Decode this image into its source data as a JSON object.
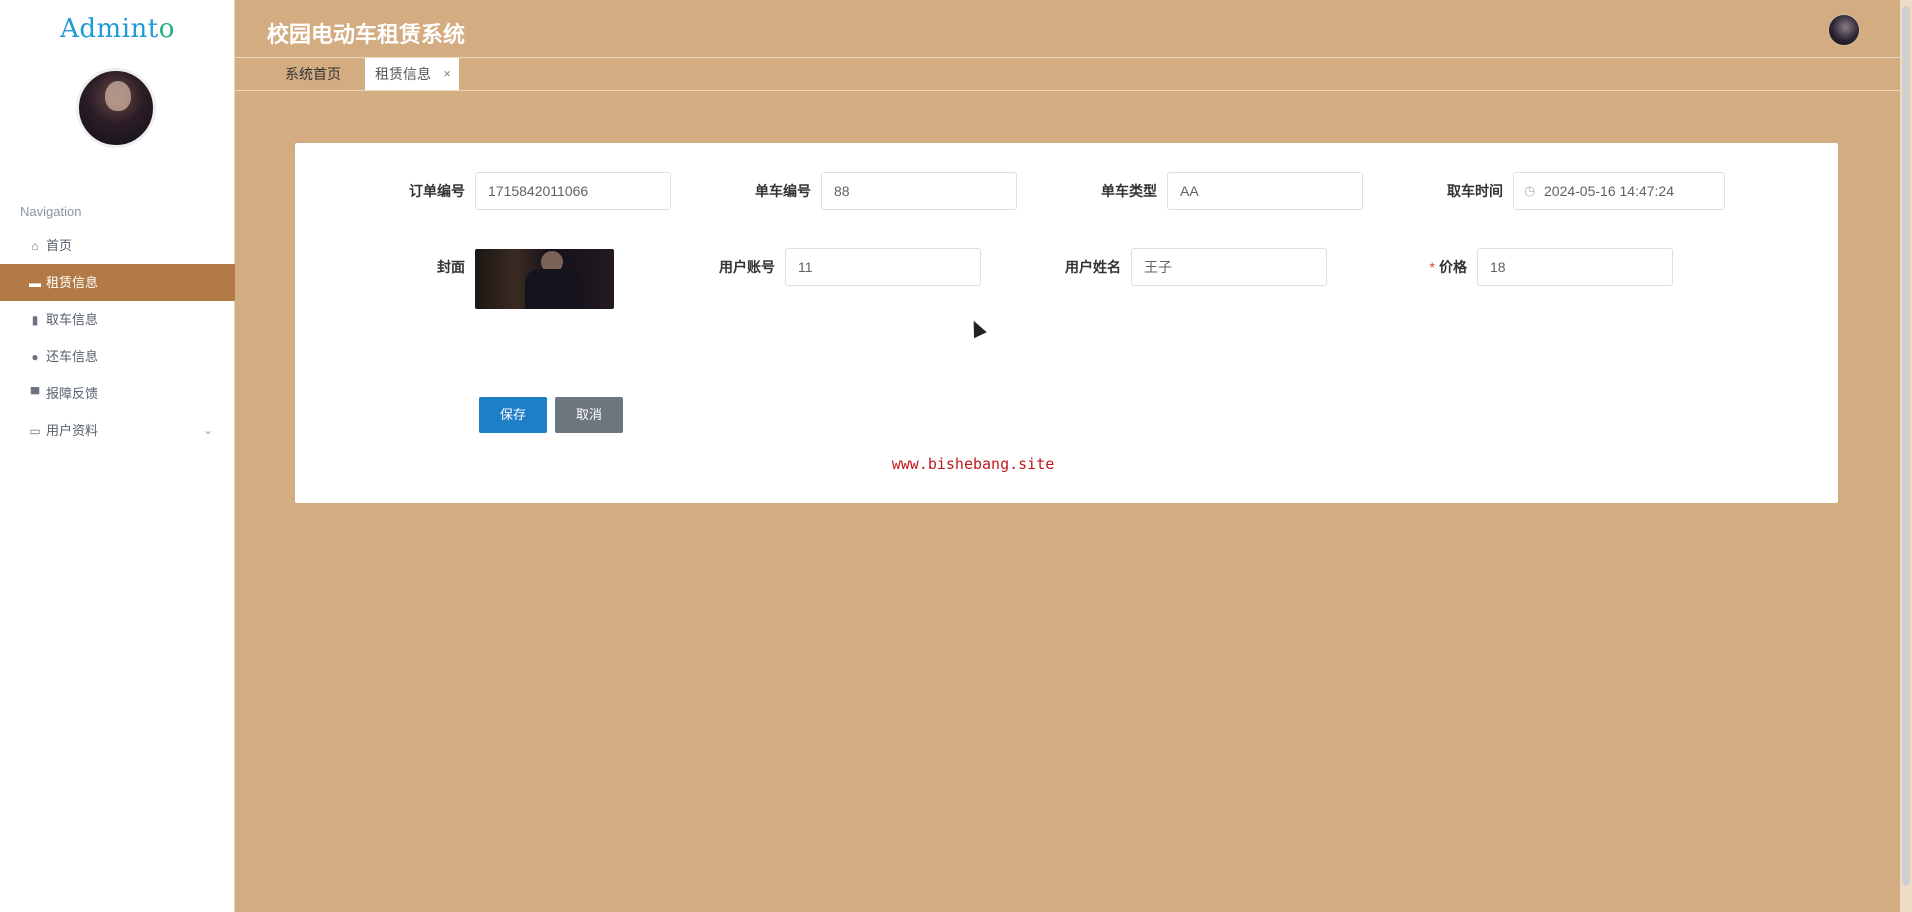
{
  "sidebar": {
    "logo_main": "Admint",
    "logo_accent": "o",
    "nav_title": "Navigation",
    "items": [
      {
        "label": "首页",
        "icon": "home-icon"
      },
      {
        "label": "租赁信息",
        "icon": "briefcase-icon"
      },
      {
        "label": "取车信息",
        "icon": "clipboard-icon"
      },
      {
        "label": "还车信息",
        "icon": "map-pin-icon"
      },
      {
        "label": "报障反馈",
        "icon": "monitor-icon"
      },
      {
        "label": "用户资料",
        "icon": "id-card-icon"
      }
    ]
  },
  "header": {
    "title": "校园电动车租赁系统"
  },
  "tabs": [
    {
      "label": "系统首页"
    },
    {
      "label": "租赁信息",
      "close": "×"
    }
  ],
  "form": {
    "order_no_label": "订单编号",
    "order_no_value": "1715842011066",
    "bike_no_label": "单车编号",
    "bike_no_value": "88",
    "bike_type_label": "单车类型",
    "bike_type_value": "AA",
    "pickup_time_label": "取车时间",
    "pickup_time_value": "2024-05-16 14:47:24",
    "cover_label": "封面",
    "account_label": "用户账号",
    "account_value": "11",
    "name_label": "用户姓名",
    "name_value": "王子",
    "price_label": "价格",
    "price_required": "*",
    "price_value": "18",
    "save_label": "保存",
    "cancel_label": "取消"
  },
  "watermark": "www.bishebang.site",
  "colors": {
    "background": "#d4ac82",
    "active_nav": "#b27a46",
    "save_button": "#1e7ec8",
    "cancel_button": "#6d767e",
    "watermark": "#c0181e"
  }
}
